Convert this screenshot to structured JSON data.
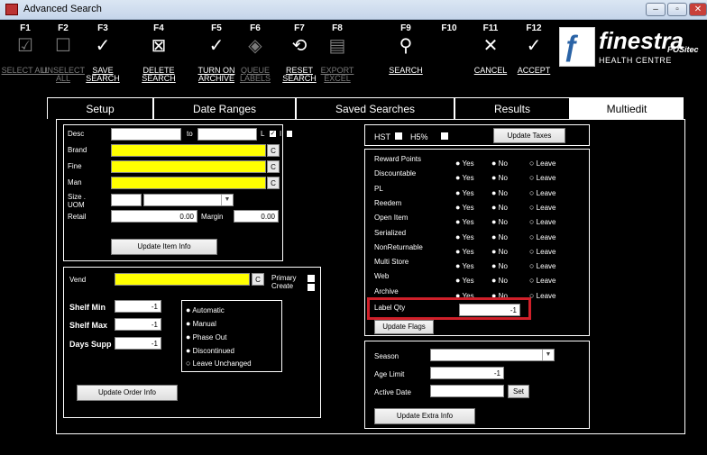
{
  "window": {
    "title": "Advanced Search",
    "controls": [
      "minimize",
      "restore",
      "close"
    ]
  },
  "toolbar": [
    {
      "key": "F1",
      "label": "SELECT ALL",
      "icon": "check-box-icon",
      "enabled": false
    },
    {
      "key": "F2",
      "label": "UNSELECT ALL",
      "icon": "empty-box-icon",
      "enabled": false
    },
    {
      "key": "F3",
      "label": "SAVE SEARCH",
      "icon": "checkmark-icon",
      "enabled": true
    },
    {
      "key": "F4",
      "label": "DELETE SEARCH",
      "icon": "x-box-icon",
      "enabled": true
    },
    {
      "key": "F5",
      "label": "TURN ON ARCHIVE",
      "icon": "checkmark-icon",
      "enabled": true
    },
    {
      "key": "F6",
      "label": "QUEUE LABELS",
      "icon": "tag-icon",
      "enabled": false
    },
    {
      "key": "F7",
      "label": "RESET SEARCH",
      "icon": "reset-icon",
      "enabled": true
    },
    {
      "key": "F8",
      "label": "EXPORT EXCEL",
      "icon": "document-icon",
      "enabled": false
    },
    {
      "key": "F9",
      "label": "SEARCH",
      "icon": "search-icon",
      "enabled": true
    },
    {
      "key": "F10",
      "label": "",
      "icon": "",
      "enabled": false
    },
    {
      "key": "F11",
      "label": "CANCEL",
      "icon": "close-icon",
      "enabled": true
    },
    {
      "key": "F12",
      "label": "ACCEPT",
      "icon": "checkmark-icon",
      "enabled": true
    }
  ],
  "brand": {
    "name": "finestra",
    "subtitle": "HEALTH CENTRE",
    "by": "by",
    "vendor": "POSitec"
  },
  "tabs": [
    "Setup",
    "Date Ranges",
    "Saved Searches",
    "Results",
    "Multiedit"
  ],
  "active_tab": "Multiedit",
  "item": {
    "desc_label": "Desc",
    "to_label": "to",
    "l_label": "L",
    "i_label": "I",
    "brand_label": "Brand",
    "fine_label": "Fine",
    "man_label": "Man",
    "size_label": "Size",
    "uom_label": "UOM",
    "retail_label": "Retail",
    "retail_value": "0.00",
    "margin_label": "Margin",
    "margin_value": "0.00",
    "c_label": "C",
    "update_button": "Update Item Info"
  },
  "order": {
    "vend_label": "Vend",
    "c_label": "C",
    "primary_label": "Primary",
    "create_label": "Create",
    "shelf_min_label": "Shelf Min",
    "shelf_min_value": "-1",
    "shelf_max_label": "Shelf Max",
    "shelf_max_value": "-1",
    "days_supp_label": "Days Supp",
    "days_supp_value": "-1",
    "status_options": [
      "Automatic",
      "Manual",
      "Phase Out",
      "Discontinued",
      "Leave Unchanged"
    ],
    "update_button": "Update Order Info"
  },
  "taxes": {
    "hst_label": "HST",
    "h5_label": "H5%",
    "update_button": "Update Taxes"
  },
  "flags": {
    "rows": [
      "Reward Points",
      "Discountable",
      "PL",
      "Reedem",
      "Open Item",
      "Serialized",
      "NonReturnable",
      "Multi Store",
      "Web",
      "Archive"
    ],
    "options": [
      "Yes",
      "No",
      "Leave"
    ],
    "label_qty_label": "Label Qty",
    "label_qty_value": "-1",
    "update_button": "Update Flags"
  },
  "extra": {
    "season_label": "Season",
    "age_limit_label": "Age Limit",
    "age_limit_value": "-1",
    "active_date_label": "Active Date",
    "set_button": "Set",
    "update_button": "Update Extra Info"
  },
  "colors": {
    "background": "#000000",
    "required_field": "#ffff00",
    "highlight": "#d0202a"
  }
}
